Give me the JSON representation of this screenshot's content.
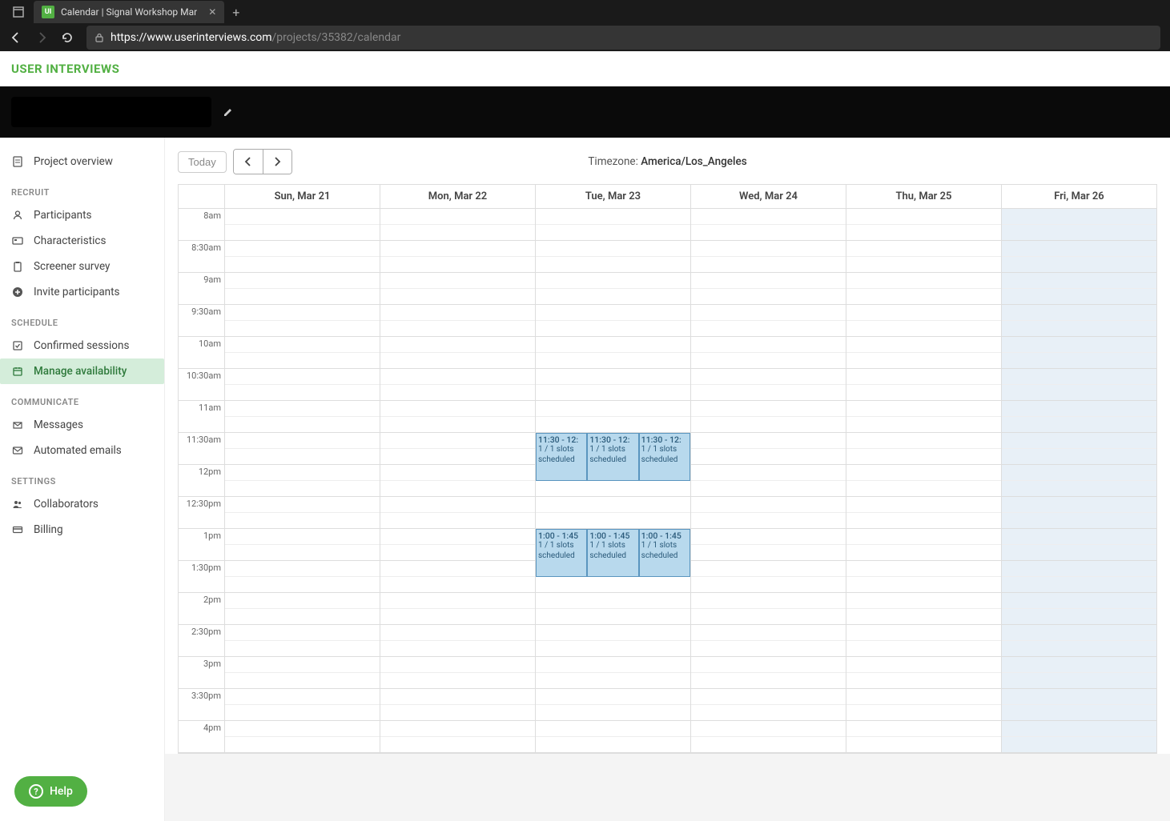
{
  "browser": {
    "tab_title": "Calendar | Signal Workshop Mar",
    "url_prefix": "https://www.userinterviews.com",
    "url_suffix": "/projects/35382/calendar"
  },
  "brand": "USER INTERVIEWS",
  "sidebar": {
    "overview": "Project overview",
    "section_recruit": "RECRUIT",
    "participants": "Participants",
    "characteristics": "Characteristics",
    "screener": "Screener survey",
    "invite": "Invite participants",
    "section_schedule": "SCHEDULE",
    "confirmed": "Confirmed sessions",
    "manage": "Manage availability",
    "section_comm": "COMMUNICATE",
    "messages": "Messages",
    "automated": "Automated emails",
    "section_settings": "SETTINGS",
    "collaborators": "Collaborators",
    "billing": "Billing"
  },
  "help_label": "Help",
  "toolbar": {
    "today": "Today",
    "timezone_label": "Timezone: ",
    "timezone_value": "America/Los_Angeles"
  },
  "days": [
    "Sun, Mar 21",
    "Mon, Mar 22",
    "Tue, Mar 23",
    "Wed, Mar 24",
    "Thu, Mar 25",
    "Fri, Mar 26"
  ],
  "times": [
    "8am",
    "8:30am",
    "9am",
    "9:30am",
    "10am",
    "10:30am",
    "11am",
    "11:30am",
    "12pm",
    "12:30pm",
    "1pm",
    "1:30pm",
    "2pm",
    "2:30pm",
    "3pm",
    "3:30pm",
    "4pm"
  ],
  "events": {
    "morning": {
      "time": "11:30 - 12:",
      "slots": "1 / 1 slots",
      "status": "scheduled"
    },
    "afternoon": {
      "time": "1:00 - 1:45",
      "slots": "1 / 1 slots",
      "status": "scheduled"
    }
  }
}
